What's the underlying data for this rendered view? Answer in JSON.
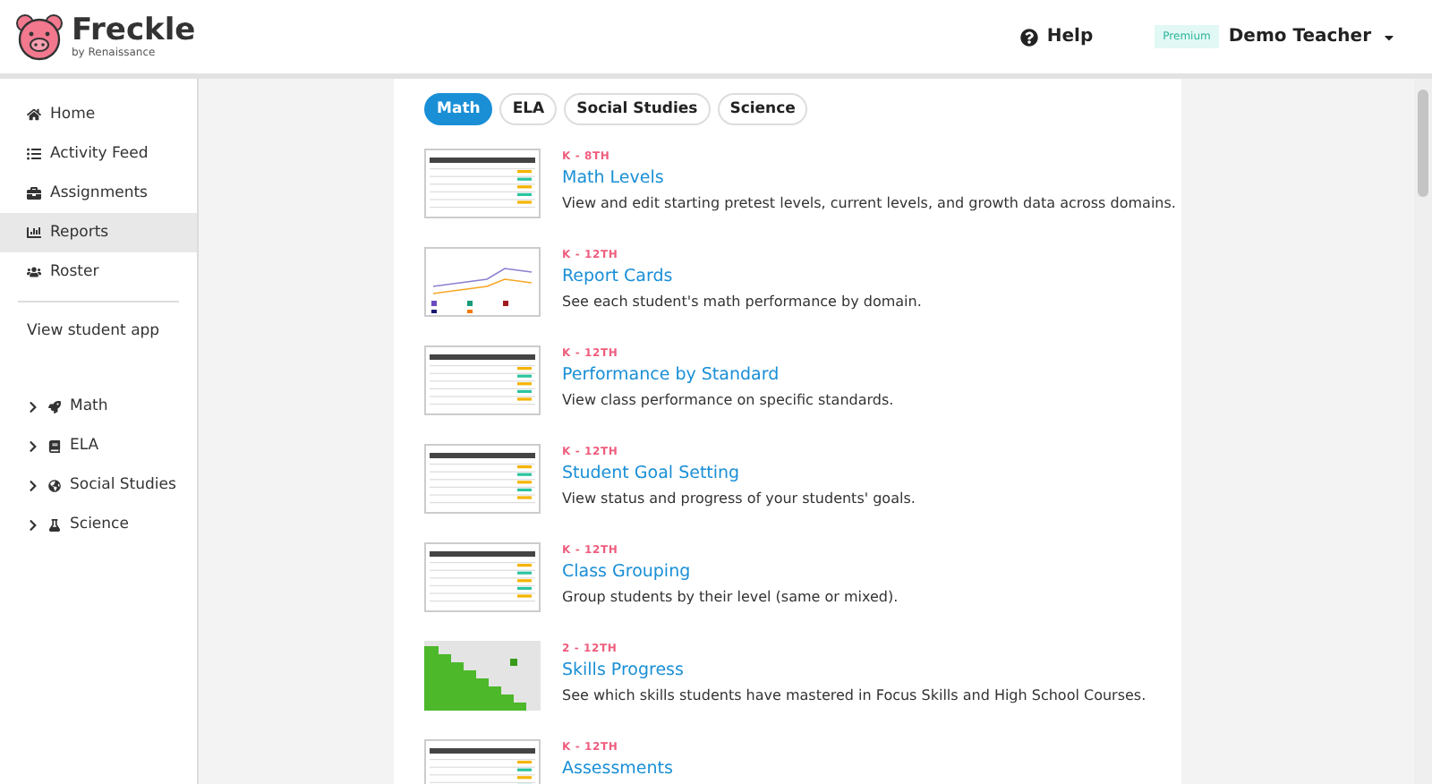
{
  "header": {
    "brand": "Freckle",
    "byline": "by Renaissance",
    "help": "Help",
    "badge": "Premium",
    "user": "Demo Teacher"
  },
  "sidebar": {
    "items": [
      {
        "label": "Home",
        "selected": false
      },
      {
        "label": "Activity Feed",
        "selected": false
      },
      {
        "label": "Assignments",
        "selected": false
      },
      {
        "label": "Reports",
        "selected": true
      },
      {
        "label": "Roster",
        "selected": false
      }
    ],
    "link": "View student app",
    "subjects": [
      {
        "label": "Math",
        "expanded": false
      },
      {
        "label": "ELA",
        "expanded": false
      },
      {
        "label": "Social Studies",
        "expanded": false
      },
      {
        "label": "Science",
        "expanded": false
      }
    ]
  },
  "tabs": [
    {
      "label": "Math",
      "selected": true
    },
    {
      "label": "ELA",
      "selected": false
    },
    {
      "label": "Social Studies",
      "selected": false
    },
    {
      "label": "Science",
      "selected": false
    }
  ],
  "reports": [
    {
      "grades": "K - 8TH",
      "title": "Math Levels",
      "description": "View and edit starting pretest levels, current levels, and growth data across domains.",
      "kind": "table"
    },
    {
      "grades": "K - 12TH",
      "title": "Report Cards",
      "description": "See each student's math performance by domain.",
      "kind": "chart"
    },
    {
      "grades": "K - 12TH",
      "title": "Performance by Standard",
      "description": "View class performance on specific standards.",
      "kind": "table"
    },
    {
      "grades": "K - 12TH",
      "title": "Student Goal Setting",
      "description": "View status and progress of your students' goals.",
      "kind": "table"
    },
    {
      "grades": "K - 12TH",
      "title": "Class Grouping",
      "description": "Group students by their level (same or mixed).",
      "kind": "table"
    },
    {
      "grades": "2 - 12TH",
      "title": "Skills Progress",
      "description": "See which skills students have mastered in Focus Skills and High School Courses.",
      "kind": "grid"
    },
    {
      "grades": "K - 12TH",
      "title": "Assessments",
      "kind": "table"
    }
  ]
}
